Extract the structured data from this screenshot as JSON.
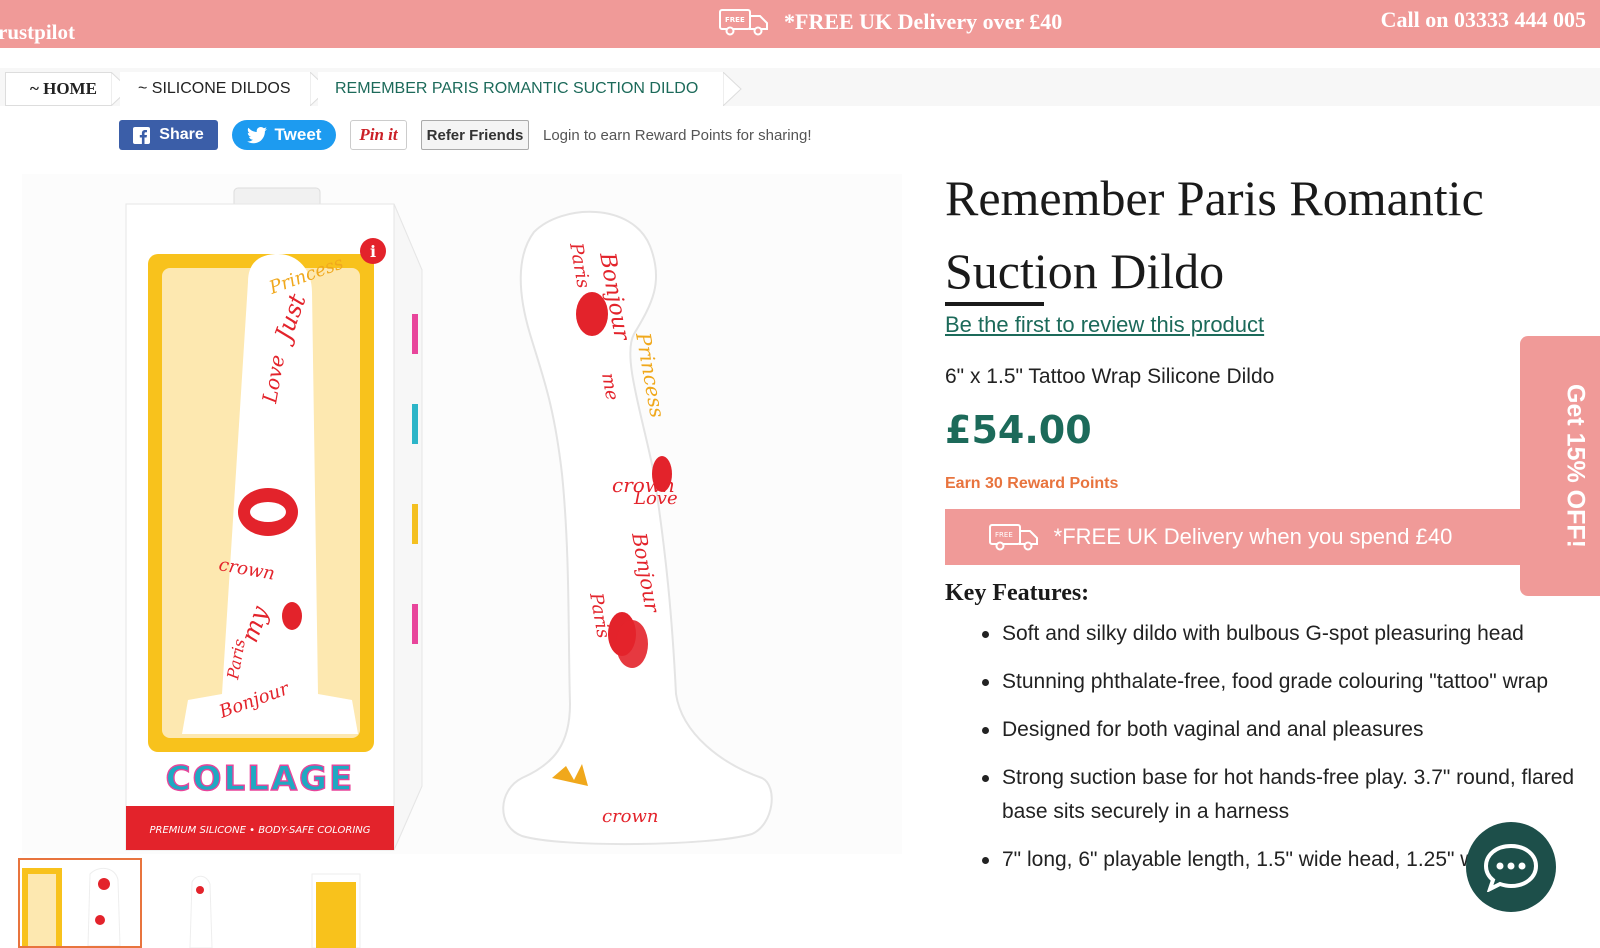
{
  "topbar": {
    "trustpilot": "rustpilot",
    "promo": "*FREE UK Delivery over £40",
    "van_badge": "FREE",
    "phone": "Call on 03333 444 005"
  },
  "breadcrumb": {
    "home": "~ HOME",
    "category": "~ SILICONE DILDOS",
    "current": "REMEMBER PARIS ROMANTIC SUCTION DILDO"
  },
  "share": {
    "facebook": "Share",
    "twitter": "Tweet",
    "pinterest": "Pin it",
    "refer": "Refer Friends",
    "note": "Login to earn Reward Points for sharing!"
  },
  "product": {
    "title": "Remember Paris Romantic Suction Dildo",
    "review_link": "Be the first to review this product",
    "subtitle": "6\" x 1.5\" Tattoo Wrap Silicone Dildo",
    "price": "£54.00",
    "reward": "Earn 30 Reward Points",
    "delivery": "*FREE UK Delivery when you spend £40",
    "delivery_badge": "FREE",
    "key_features_title": "Key Features:",
    "features": [
      "Soft and silky dildo with bulbous G-spot pleasuring head",
      "Stunning phthalate-free, food grade colouring \"tattoo\" wrap",
      "Designed for both vaginal and anal pleasures",
      "Strong suction base for hot hands-free play. 3.7\" round, flared base sits securely in a harness",
      "7\" long, 6\" playable length, 1.5\" wide head, 1.25\" wide"
    ]
  },
  "gallery": {
    "box_brand": "COLLAGE",
    "box_tagline": "PREMIUM SILICONE • BODY-SAFE COLORING",
    "tattoo_words": [
      "Bonjour",
      "Paris",
      "Princess",
      "Love",
      "crown",
      "me",
      "Just",
      "my"
    ]
  },
  "side_tab": "Get 15% OFF!",
  "colors": {
    "accent_pink": "#f09a98",
    "brand_green": "#1c6a5a",
    "reward_orange": "#e8743e",
    "chat_bg": "#1d4f4a"
  }
}
